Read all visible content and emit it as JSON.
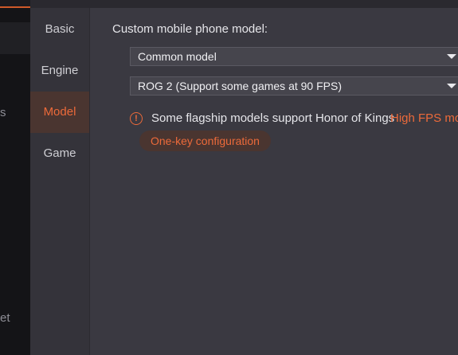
{
  "left_strip": {
    "fragments": [
      "s",
      "et"
    ]
  },
  "nav": {
    "items": [
      {
        "label": "Basic"
      },
      {
        "label": "Engine"
      },
      {
        "label": "Model"
      },
      {
        "label": "Game"
      }
    ],
    "active_index": 2
  },
  "content": {
    "title": "Custom mobile phone model:",
    "model_type_select": {
      "value": "Common model"
    },
    "model_select": {
      "value": "ROG 2 (Support some games at 90 FPS)"
    },
    "notice": {
      "icon": "warning-circle-icon",
      "text": "Some flagship models support Honor of Kings",
      "link_text": "High FPS mode"
    },
    "one_key_button": "One-key configuration"
  },
  "colors": {
    "accent": "#ec6a3a",
    "background": "#3a3941",
    "nav_bg": "#34333a"
  }
}
